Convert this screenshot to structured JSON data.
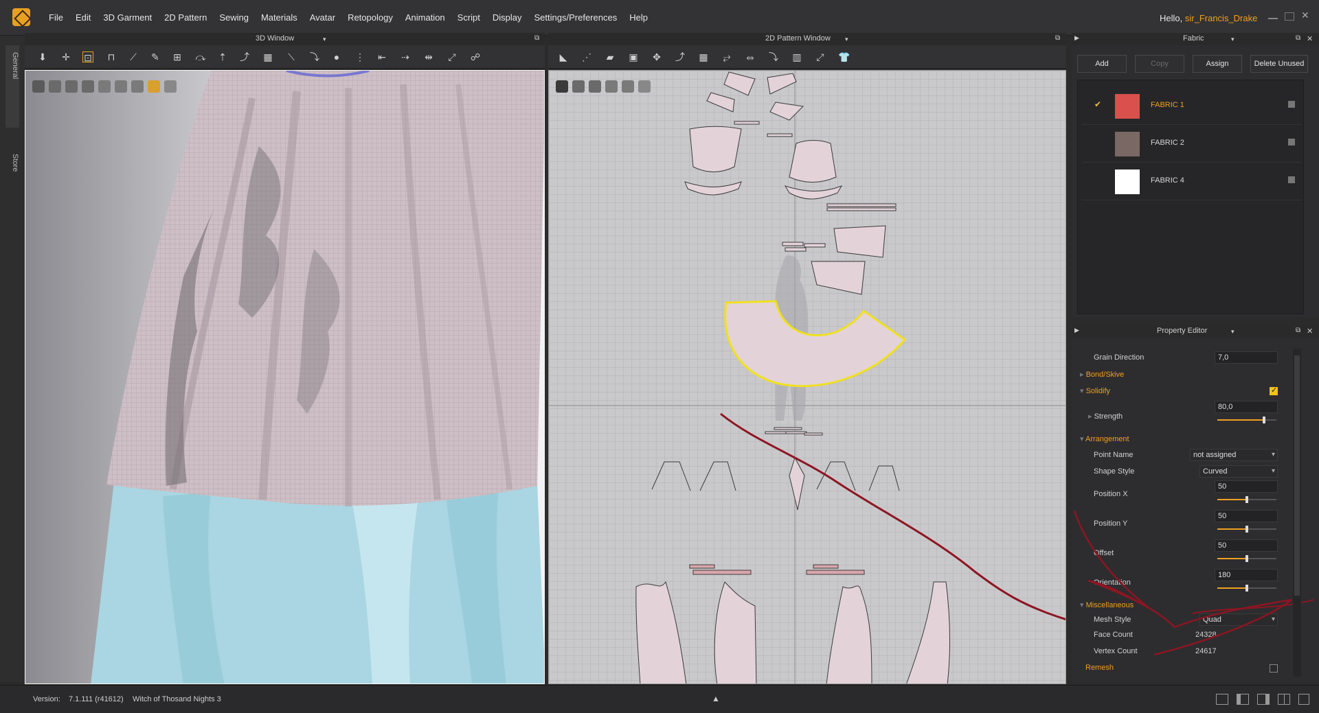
{
  "app": {
    "menus": [
      "File",
      "Edit",
      "3D Garment",
      "2D Pattern",
      "Sewing",
      "Materials",
      "Avatar",
      "Retopology",
      "Animation",
      "Script",
      "Display",
      "Settings/Preferences",
      "Help"
    ],
    "greeting_prefix": "Hello,",
    "username": "sir_Francis_Drake",
    "accent": "#f0a020"
  },
  "side_tabs": [
    "General",
    "Store"
  ],
  "window3d": {
    "title": "3D Window"
  },
  "window2d": {
    "title": "2D Pattern Window"
  },
  "fabric_panel": {
    "title": "Fabric",
    "buttons": {
      "add": "Add",
      "copy": "Copy",
      "assign": "Assign",
      "delete_unused": "Delete Unused"
    },
    "fabrics": [
      {
        "name": "FABRIC 1",
        "color": "#d9504c",
        "selected": true
      },
      {
        "name": "FABRIC 2",
        "color": "#7a6864",
        "selected": false
      },
      {
        "name": "FABRIC 4",
        "color": "#ffffff",
        "selected": false
      }
    ]
  },
  "property_editor": {
    "title": "Property Editor",
    "grain_direction": {
      "label": "Grain Direction",
      "value": "7,0"
    },
    "bond_skive": {
      "label": "Bond/Skive"
    },
    "solidify": {
      "label": "Solidify",
      "checked": true
    },
    "strength": {
      "label": "Strength",
      "value": "80,0",
      "level": 0.8
    },
    "arrangement": {
      "label": "Arrangement"
    },
    "point_name": {
      "label": "Point Name",
      "value": "not assigned"
    },
    "shape_style": {
      "label": "Shape Style",
      "value": "Curved"
    },
    "position_x": {
      "label": "Position X",
      "value": "50",
      "level": 0.5
    },
    "position_y": {
      "label": "Position Y",
      "value": "50",
      "level": 0.5
    },
    "offset": {
      "label": "Offset",
      "value": "50",
      "level": 0.5
    },
    "orientation": {
      "label": "Orientation",
      "value": "180",
      "level": 0.5
    },
    "miscellaneous": {
      "label": "Miscellaneous"
    },
    "mesh_style": {
      "label": "Mesh Style",
      "value": "Quad"
    },
    "face_count": {
      "label": "Face Count",
      "value": "24328"
    },
    "vertex_count": {
      "label": "Vertex Count",
      "value": "24617"
    },
    "remesh": {
      "label": "Remesh",
      "checked": false
    }
  },
  "status": {
    "version_label": "Version:",
    "version": "7.1.111 (r41612)",
    "project": "Witch of Thosand Nights 3"
  },
  "icons": [
    "logo-icon",
    "toolbar-tool-icons",
    "layout-icons",
    "check-icon",
    "expand-arrow-icon"
  ]
}
